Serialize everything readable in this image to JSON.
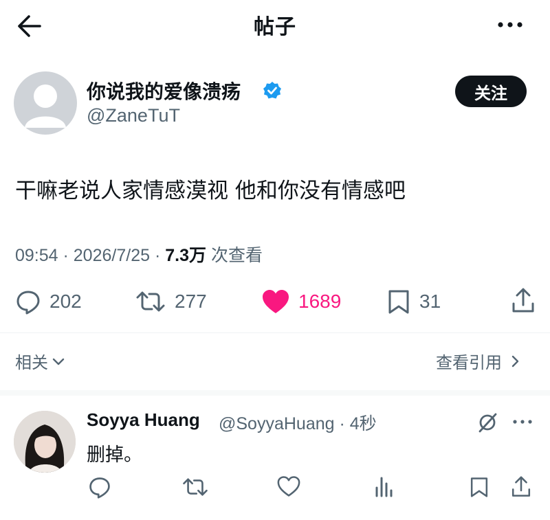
{
  "topbar": {
    "title": "帖子"
  },
  "post": {
    "author_name": "你说我的爱像溃疡",
    "author_handle": "@ZaneTuT",
    "verified": true,
    "follow_label": "关注",
    "text": "干嘛老说人家情感漠视 他和你没有情感吧",
    "time": "09:54",
    "date": "2026/7/25",
    "views_count": "7.3万",
    "views_label": "次查看"
  },
  "stats": {
    "replies": "202",
    "retweets": "277",
    "likes": "1689",
    "bookmarks": "31"
  },
  "related": {
    "label": "相关",
    "quotes_label": "查看引用"
  },
  "reply": {
    "author_name": "Soyya Huang",
    "handle_time": "@SoyyaHuang · 4秒",
    "text": "删掉。"
  },
  "colors": {
    "like": "#f91880",
    "verified": "#1d9bf0",
    "text_secondary": "#536471"
  }
}
